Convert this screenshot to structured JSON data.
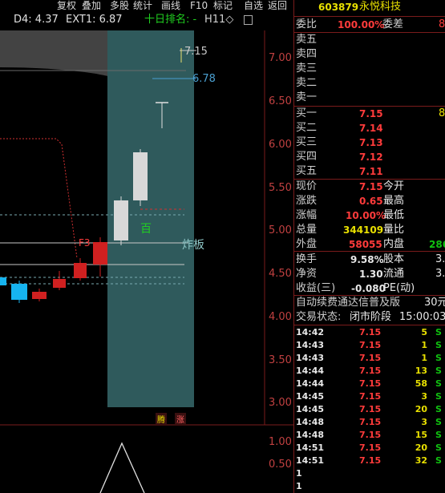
{
  "toolbar": {
    "items": [
      "复权",
      "叠加",
      "多股",
      "统计",
      "画线",
      "F10",
      "标记",
      "自选",
      "返回"
    ]
  },
  "chart_header": {
    "d4": "D4: 4.37",
    "ext1": "EXT1: 6.87",
    "rank_label": "十日排名: -",
    "h11": "H11◇"
  },
  "price_axis": {
    "ticks": [
      "7.00",
      "6.50",
      "6.00",
      "5.50",
      "5.00",
      "4.50",
      "4.00",
      "3.50",
      "3.00"
    ]
  },
  "volume_axis": {
    "ticks": [
      "1.00",
      "0.50"
    ]
  },
  "annotations": {
    "high_label": "7.15",
    "ext_label": "6.78",
    "hundred": "百",
    "blast": "炸板",
    "f3": "F3",
    "markers": [
      "腾",
      "涨"
    ]
  },
  "stock": {
    "code": "603879",
    "name": "永悦科技"
  },
  "order_book": {
    "weibi_label": "委比",
    "weibi_value": "100.00%",
    "weicha_label": "委差",
    "weicha_value": "8",
    "asks": [
      {
        "label": "卖五",
        "price": "",
        "vol": ""
      },
      {
        "label": "卖四",
        "price": "",
        "vol": ""
      },
      {
        "label": "卖三",
        "price": "",
        "vol": ""
      },
      {
        "label": "卖二",
        "price": "",
        "vol": ""
      },
      {
        "label": "卖一",
        "price": "",
        "vol": ""
      }
    ],
    "bids": [
      {
        "label": "买一",
        "price": "7.15",
        "vol": "8"
      },
      {
        "label": "买二",
        "price": "7.14",
        "vol": ""
      },
      {
        "label": "买三",
        "price": "7.13",
        "vol": ""
      },
      {
        "label": "买四",
        "price": "7.12",
        "vol": ""
      },
      {
        "label": "买五",
        "price": "7.11",
        "vol": ""
      }
    ]
  },
  "quote": {
    "xianjia_label": "现价",
    "xianjia": "7.15",
    "jinkai_label": "今开",
    "zhangdie_label": "涨跌",
    "zhangdie": "0.65",
    "zuigao_label": "最高",
    "zhangfu_label": "涨幅",
    "zhangfu": "10.00%",
    "zuidi_label": "最低",
    "zongliang_label": "总量",
    "zongliang": "344109",
    "liangbi_label": "量比",
    "waipan_label": "外盘",
    "waipan": "58055",
    "neipan_label": "内盘",
    "neipan": "286"
  },
  "fundamentals": {
    "huanshou_label": "换手",
    "huanshou": "9.58%",
    "guben_label": "股本",
    "guben": "3.",
    "jingzi_label": "净资",
    "jingzi": "1.30",
    "liutong_label": "流通",
    "liutong": "3.",
    "shouyi_label": "收益(三)",
    "shouyi": "-0.080",
    "pe_label": "PE(动)"
  },
  "banner": {
    "text": "自动续费通达信普及版",
    "price": "30元"
  },
  "trade_status": {
    "label": "交易状态:",
    "value": "闭市阶段",
    "time": "15:00:03"
  },
  "ticks": [
    {
      "time": "14:42",
      "price": "7.15",
      "vol": "5",
      "side": "S"
    },
    {
      "time": "14:43",
      "price": "7.15",
      "vol": "1",
      "side": "S"
    },
    {
      "time": "14:43",
      "price": "7.15",
      "vol": "1",
      "side": "S"
    },
    {
      "time": "14:44",
      "price": "7.15",
      "vol": "13",
      "side": "S"
    },
    {
      "time": "14:44",
      "price": "7.15",
      "vol": "58",
      "side": "S"
    },
    {
      "time": "14:45",
      "price": "7.15",
      "vol": "3",
      "side": "S"
    },
    {
      "time": "14:45",
      "price": "7.15",
      "vol": "20",
      "side": "S"
    },
    {
      "time": "14:48",
      "price": "7.15",
      "vol": "3",
      "side": "S"
    },
    {
      "time": "14:48",
      "price": "7.15",
      "vol": "15",
      "side": "S"
    },
    {
      "time": "14:51",
      "price": "7.15",
      "vol": "20",
      "side": "S"
    },
    {
      "time": "14:51",
      "price": "7.15",
      "vol": "32",
      "side": "S"
    }
  ],
  "tail_rows": [
    "1",
    "1"
  ],
  "colors": {
    "up": "#ff3b3b",
    "down": "#16b4f0",
    "zone": "#2f5a5c",
    "grid": "#7a1b1b"
  }
}
